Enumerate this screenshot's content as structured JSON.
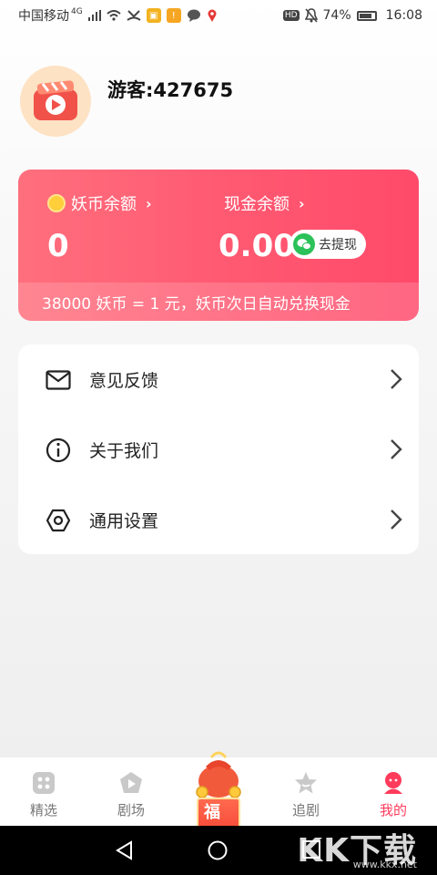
{
  "status_bar": {
    "carrier": "中国移动",
    "network": "4G",
    "battery_percent": "74%",
    "time": "16:08",
    "hd_badge": "HD"
  },
  "profile": {
    "username": "游客:427675"
  },
  "wallet": {
    "coin_label": "妖币余额",
    "coin_value": "0",
    "cash_label": "现金余额",
    "cash_value": "0.00",
    "withdraw_label": "去提现",
    "note": "38000 妖币 = 1 元，妖币次日自动兑换现金",
    "colors": {
      "start": "#ff6f7d",
      "end": "#ff4a6a"
    }
  },
  "menu": {
    "items": [
      {
        "label": "意见反馈",
        "icon": "mail-icon"
      },
      {
        "label": "关于我们",
        "icon": "info-icon"
      },
      {
        "label": "通用设置",
        "icon": "settings-hexagon-icon"
      }
    ]
  },
  "tab_bar": {
    "tabs": [
      {
        "label": "精选",
        "icon": "featured-icon",
        "active": false
      },
      {
        "label": "剧场",
        "icon": "theater-play-icon",
        "active": false
      },
      {
        "label": "福利",
        "icon": "gift-bag-icon",
        "active": false
      },
      {
        "label": "追剧",
        "icon": "star-follow-icon",
        "active": false
      },
      {
        "label": "我的",
        "icon": "profile-icon",
        "active": true
      }
    ],
    "active_color": "#ff3b5c"
  },
  "watermark": {
    "text": "KK下载",
    "url": "www.kkx.net"
  }
}
